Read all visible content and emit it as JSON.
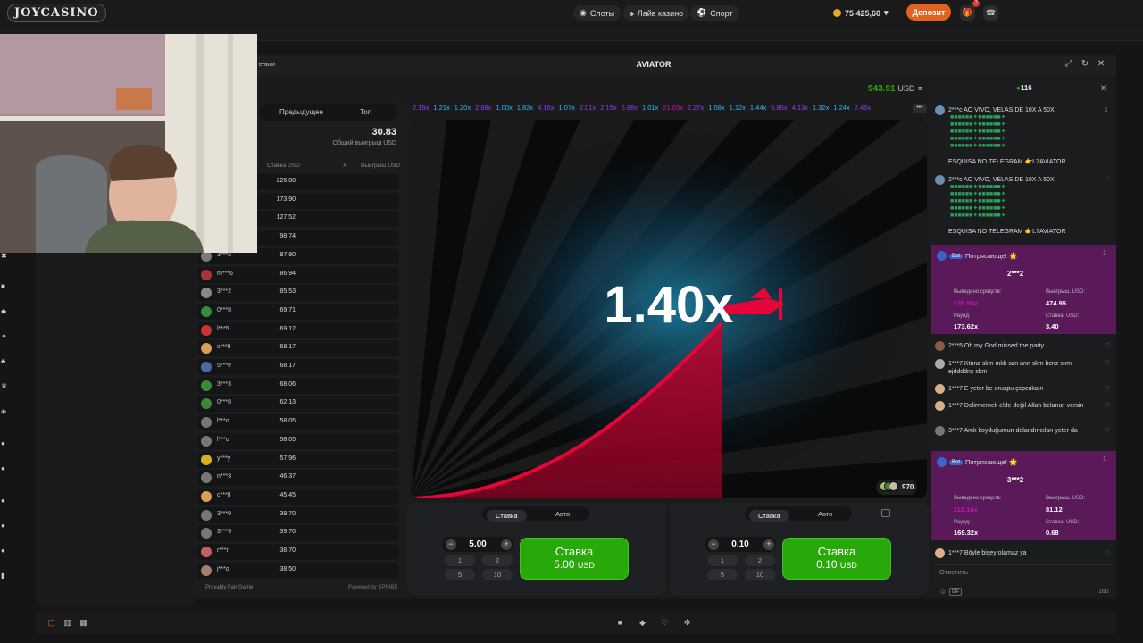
{
  "topbar": {
    "logo": "JOYCASINO",
    "nav": [
      {
        "label": "Слоты",
        "icon": "slots-icon"
      },
      {
        "label": "Лайв казино",
        "icon": "live-casino-icon"
      },
      {
        "label": "Спорт",
        "icon": "sport-icon"
      }
    ],
    "balance": "75 425,60",
    "deposit_label": "Депозит",
    "notification_count": "7"
  },
  "game": {
    "window_title": "AVIATOR",
    "left_caption": "еньги",
    "balance_amount": "943.91",
    "balance_currency": "USD",
    "multiplier": "1.40x",
    "players_online_in_round": "970",
    "history": [
      {
        "v": "2.19x",
        "c": "#913ef8"
      },
      {
        "v": "1.21x",
        "c": "#34b4ff"
      },
      {
        "v": "1.20x",
        "c": "#34b4ff"
      },
      {
        "v": "2.88x",
        "c": "#913ef8"
      },
      {
        "v": "1.00x",
        "c": "#34b4ff"
      },
      {
        "v": "1.82x",
        "c": "#34b4ff"
      },
      {
        "v": "4.16x",
        "c": "#913ef8"
      },
      {
        "v": "1.07x",
        "c": "#34b4ff"
      },
      {
        "v": "2.01x",
        "c": "#913ef8"
      },
      {
        "v": "2.15x",
        "c": "#913ef8"
      },
      {
        "v": "6.88x",
        "c": "#913ef8"
      },
      {
        "v": "1.01x",
        "c": "#34b4ff"
      },
      {
        "v": "21.03x",
        "c": "#c017b4"
      },
      {
        "v": "2.27x",
        "c": "#913ef8"
      },
      {
        "v": "1.08x",
        "c": "#34b4ff"
      },
      {
        "v": "1.12x",
        "c": "#34b4ff"
      },
      {
        "v": "1.44x",
        "c": "#34b4ff"
      },
      {
        "v": "5.86x",
        "c": "#913ef8"
      },
      {
        "v": "4.13x",
        "c": "#913ef8"
      },
      {
        "v": "1.32x",
        "c": "#34b4ff"
      },
      {
        "v": "1.24x",
        "c": "#34b4ff"
      },
      {
        "v": "2.46x",
        "c": "#913ef8"
      }
    ]
  },
  "bets": {
    "tabs": [
      "Предыдущее",
      "Топ"
    ],
    "total_amount": "30.83",
    "total_label": "Общий выигрыш USD",
    "col_bet": "Ставка USD",
    "col_x": "X",
    "col_win": "Выигрыш USD",
    "rows": [
      {
        "user": "",
        "amount": "226.88",
        "av": "#555"
      },
      {
        "user": "",
        "amount": "173.90",
        "av": "#555"
      },
      {
        "user": "",
        "amount": "127.52",
        "av": "#555"
      },
      {
        "user": "",
        "amount": "98.74",
        "av": "#555"
      },
      {
        "user": "3***2",
        "amount": "87.80",
        "av": "#7a7a7a"
      },
      {
        "user": "m***6",
        "amount": "86.94",
        "av": "#a33"
      },
      {
        "user": "3***2",
        "amount": "85.53",
        "av": "#888"
      },
      {
        "user": "0***8",
        "amount": "69.71",
        "av": "#3a8a3a"
      },
      {
        "user": "l***5",
        "amount": "69.12",
        "av": "#c33"
      },
      {
        "user": "c***8",
        "amount": "68.17",
        "av": "#d8a050"
      },
      {
        "user": "5***e",
        "amount": "68.17",
        "av": "#4a6aa8"
      },
      {
        "user": "3***3",
        "amount": "68.06",
        "av": "#3a8a3a"
      },
      {
        "user": "0***8",
        "amount": "62.13",
        "av": "#3a8a3a"
      },
      {
        "user": "l***o",
        "amount": "58.05",
        "av": "#777"
      },
      {
        "user": "l***o",
        "amount": "58.05",
        "av": "#777"
      },
      {
        "user": "y***y",
        "amount": "57.96",
        "av": "#d8b020"
      },
      {
        "user": "n***3",
        "amount": "46.37",
        "av": "#777"
      },
      {
        "user": "c***8",
        "amount": "45.45",
        "av": "#d8a050"
      },
      {
        "user": "3***9",
        "amount": "39.70",
        "av": "#777"
      },
      {
        "user": "3***9",
        "amount": "39.70",
        "av": "#777"
      },
      {
        "user": "r***r",
        "amount": "38.70",
        "av": "#c06060"
      },
      {
        "user": "j***o",
        "amount": "38.50",
        "av": "#a08070"
      }
    ],
    "provably_fair": "Provably Fair Game",
    "powered_by": "Powered by SPRIBE"
  },
  "betpanels": [
    {
      "tab_bet": "Ставка",
      "tab_auto": "Авто",
      "value": "5.00",
      "quick": [
        "1",
        "2",
        "5",
        "10"
      ],
      "btn_label": "Ставка",
      "btn_amount": "5.00",
      "btn_currency": "USD"
    },
    {
      "tab_bet": "Ставка",
      "tab_auto": "Авто",
      "value": "0.10",
      "quick": [
        "1",
        "2",
        "5",
        "10"
      ],
      "btn_label": "Ставка",
      "btn_amount": "0.10",
      "btn_currency": "USD"
    }
  ],
  "chat": {
    "online": "116",
    "messages": {
      "m1_user": "2***c",
      "m1_text": "AO VIVO, VELAS DE 10X A 50X",
      "m1_tail": "ESQUISA NO TELEGRAM 👉L7AVIATOR",
      "m1_likes": "1",
      "m2_user": "2***c",
      "m2_text": "AO VIVO, VELAS DE 10X A 50X",
      "m2_tail": "ESQUISA NO TELEGRAM 👉L7AVIATOR",
      "win1_bot": "Bot",
      "win1_text": "Потрясающе! 🌟",
      "win1_likes": "1",
      "win1_user": "2***2",
      "win1_cashed_label": "Выведено средств:",
      "win1_cashed": "139.58x",
      "win1_win_label": "Выигрыш, USD:",
      "win1_win": "474.95",
      "win1_round_label": "Раунд:",
      "win1_round": "173.62x",
      "win1_bet_label": "Ставка, USD:",
      "win1_bet": "3.40",
      "c1": "2***5 Oh my God missed the party",
      "c2": "1***7 Ktnnz skm mkk szn ann skm bcnz skm ejddddnx skm",
      "c3": "1***7 E yeter be oruspu çcpcukaln",
      "c4": "1***7 Delirmemek elde değil Allah belanızı versin",
      "c5": "3***7 Amk koyduğumun dolandıncıları yeter da",
      "win2_bot": "Bot",
      "win2_text": "Потрясающе! 🌟",
      "win2_likes": "1",
      "win2_user": "3***2",
      "win2_cashed_label": "Выведено средств:",
      "win2_cashed": "119.16x",
      "win2_win_label": "Выигрыш, USD:",
      "win2_win": "81.12",
      "win2_round_label": "Раунд:",
      "win2_round": "169.32x",
      "win2_bet_label": "Ставка, USD:",
      "win2_bet": "0.68",
      "c6": "1***7 Böyle bişey olamaz ya"
    },
    "reply_placeholder": "Ответить",
    "gif_label": "GIF",
    "char_count": "160"
  },
  "colors": {
    "accent_green": "#28a909",
    "deposit_orange": "#e2631f",
    "plane_red": "#e50539"
  }
}
